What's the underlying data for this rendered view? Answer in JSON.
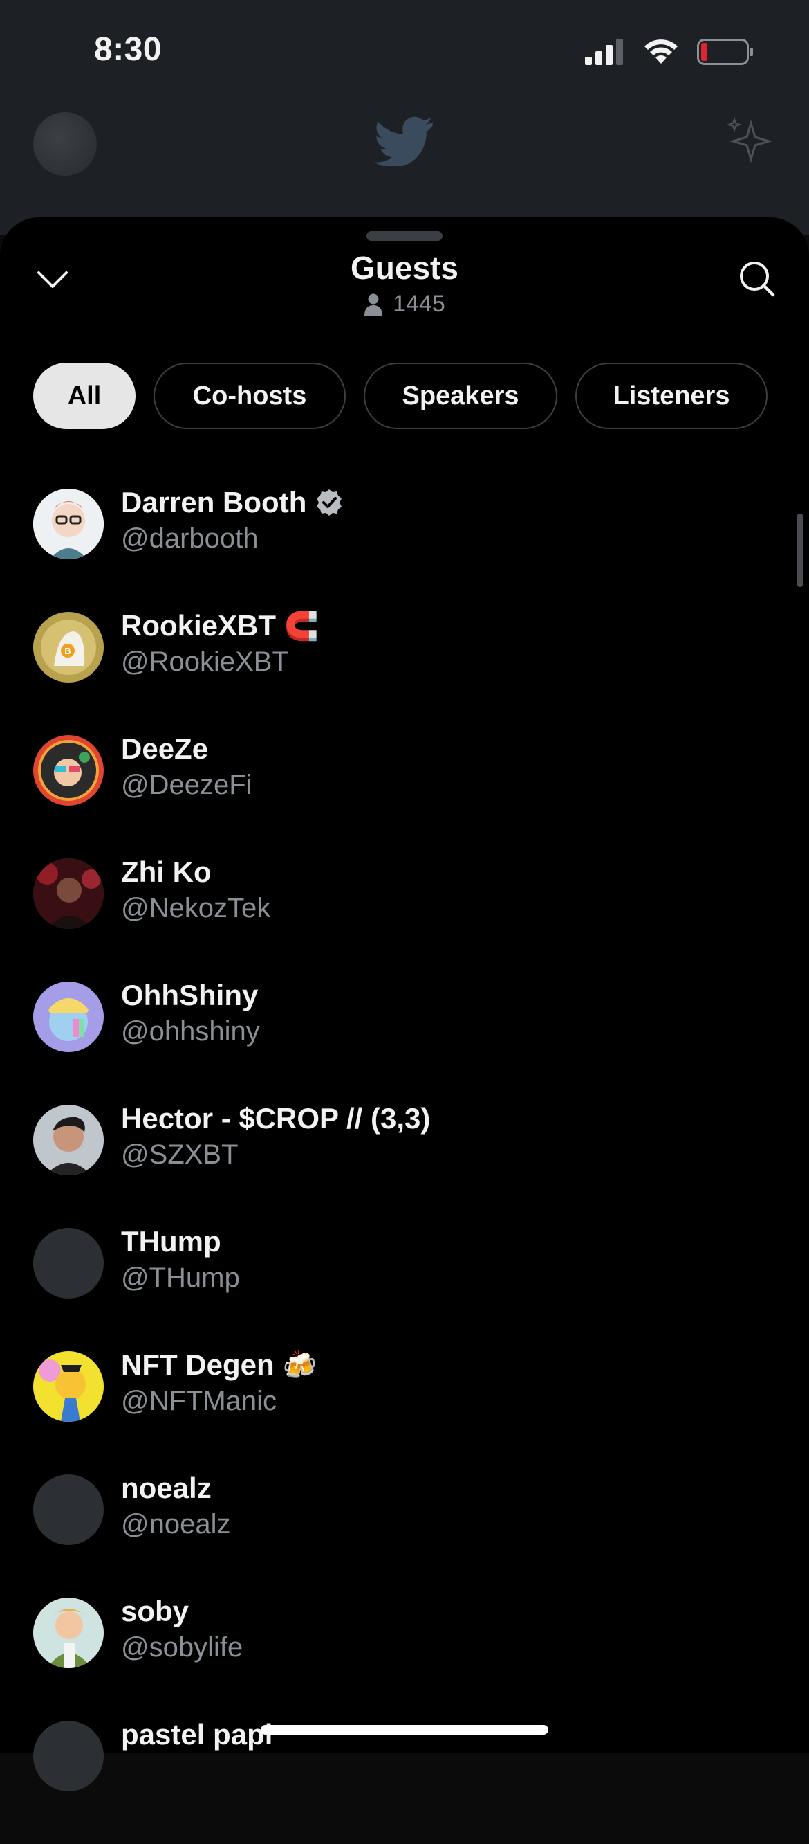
{
  "status_bar": {
    "time": "8:30",
    "battery_color": "#e0242f"
  },
  "sheet": {
    "title": "Guests",
    "count": "1445",
    "tabs": [
      {
        "label": "All",
        "active": true
      },
      {
        "label": "Co-hosts",
        "active": false
      },
      {
        "label": "Speakers",
        "active": false
      },
      {
        "label": "Listeners",
        "active": false
      }
    ]
  },
  "guests": [
    {
      "name": "Darren Booth",
      "handle": "@darbooth",
      "verified": true,
      "emoji": ""
    },
    {
      "name": "RookieXBT",
      "handle": "@RookieXBT",
      "verified": false,
      "emoji": "🧲"
    },
    {
      "name": "DeeZe",
      "handle": "@DeezeFi",
      "verified": false,
      "emoji": ""
    },
    {
      "name": "Zhi Ko",
      "handle": "@NekozTek",
      "verified": false,
      "emoji": ""
    },
    {
      "name": "OhhShiny",
      "handle": "@ohhshiny",
      "verified": false,
      "emoji": ""
    },
    {
      "name": "Hector - $CROP // (3,3)",
      "handle": "@SZXBT",
      "verified": false,
      "emoji": ""
    },
    {
      "name": "THump",
      "handle": "@THump",
      "verified": false,
      "emoji": ""
    },
    {
      "name": "NFT Degen",
      "handle": "@NFTManic",
      "verified": false,
      "emoji": "🍻"
    },
    {
      "name": "noealz",
      "handle": "@noealz",
      "verified": false,
      "emoji": ""
    },
    {
      "name": "soby",
      "handle": "@sobylife",
      "verified": false,
      "emoji": ""
    },
    {
      "name": "pastel papi",
      "handle": "",
      "verified": false,
      "emoji": ""
    }
  ]
}
